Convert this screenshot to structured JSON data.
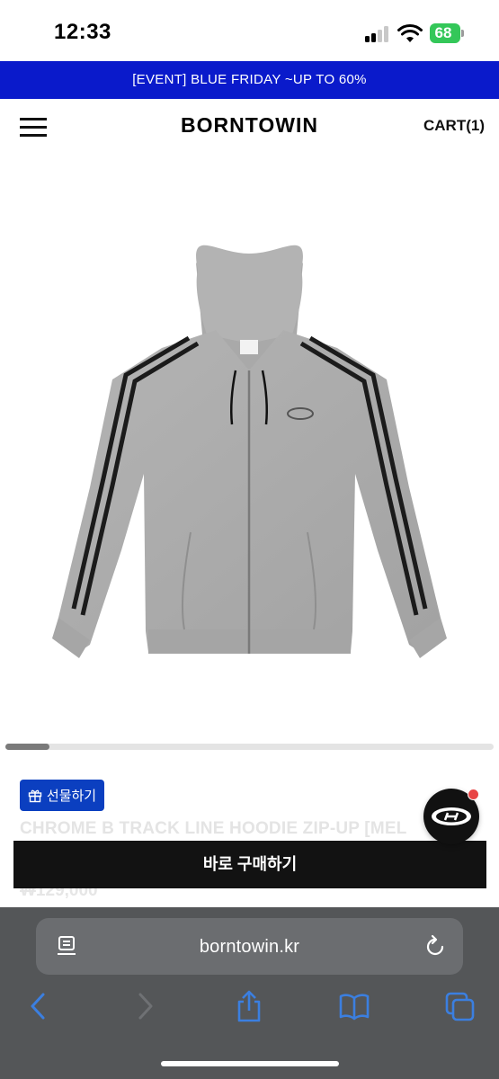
{
  "status_bar": {
    "time": "12:33",
    "battery": "68"
  },
  "banner": {
    "text": "[EVENT] BLUE FRIDAY ~UP TO 60%"
  },
  "header": {
    "brand": "BORNTOWIN",
    "cart": "CART(1)"
  },
  "product": {
    "gift_label": "선물하기",
    "name": "CHROME B TRACK LINE HOODIE ZIP-UP [MEL",
    "price": "₩129,000",
    "image_progress": 0.09
  },
  "actions": {
    "buy_now": "바로 구매하기"
  },
  "browser": {
    "url": "borntowin.kr"
  },
  "colors": {
    "banner_bg": "#0a1acb",
    "gift_button_bg": "#0b3fc0",
    "buy_button_bg": "#121212",
    "battery": "#34c759",
    "browser_bar": "#545658",
    "safari_blue": "#3b7fe0"
  },
  "icons": [
    "menu-icon",
    "gift-icon",
    "reader-icon",
    "reload-icon",
    "back-icon",
    "forward-icon",
    "share-icon",
    "bookmarks-icon",
    "tabs-icon",
    "brand-logo-icon"
  ]
}
